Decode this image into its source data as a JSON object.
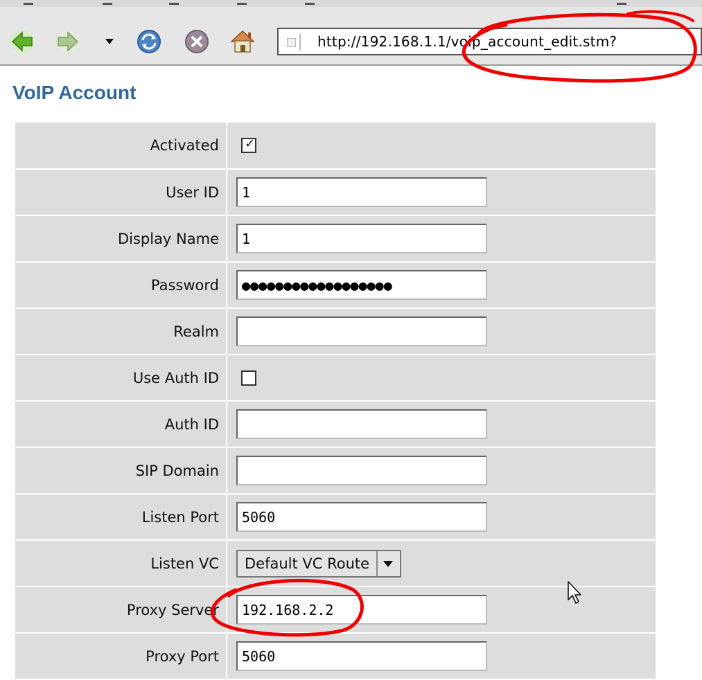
{
  "toolbar": {
    "back_icon": "back-arrow-icon",
    "forward_icon": "forward-arrow-icon",
    "reload_icon": "reload-icon",
    "stop_icon": "stop-icon",
    "home_icon": "home-icon",
    "url": "http://192.168.1.1/voip_account_edit.stm?"
  },
  "page": {
    "title": "VoIP Account"
  },
  "form": {
    "activated": {
      "label": "Activated",
      "checked": true
    },
    "user_id": {
      "label": "User ID",
      "value": "1"
    },
    "display_name": {
      "label": "Display Name",
      "value": "1"
    },
    "password": {
      "label": "Password",
      "value": "●●●●●●●●●●●●●●●●●●"
    },
    "realm": {
      "label": "Realm",
      "value": ""
    },
    "use_auth_id": {
      "label": "Use Auth ID",
      "checked": false
    },
    "auth_id": {
      "label": "Auth ID",
      "value": ""
    },
    "sip_domain": {
      "label": "SIP Domain",
      "value": ""
    },
    "listen_port": {
      "label": "Listen Port",
      "value": "5060"
    },
    "listen_vc": {
      "label": "Listen VC",
      "value": "Default VC Route"
    },
    "proxy_server": {
      "label": "Proxy Server",
      "value": "192.168.2.2"
    },
    "proxy_port": {
      "label": "Proxy Port",
      "value": "5060"
    }
  },
  "colors": {
    "title": "#336699",
    "table_bg": "#dddddd",
    "annotation": "#ee0000"
  }
}
